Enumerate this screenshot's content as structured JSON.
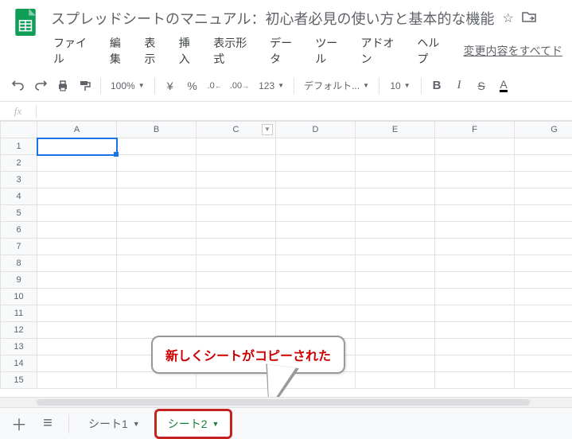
{
  "doc": {
    "title": "スプレッドシートのマニュアル：初心者必見の使い方と基本的な機能"
  },
  "menu": {
    "file": "ファイル",
    "edit": "編集",
    "view": "表示",
    "insert": "挿入",
    "format": "表示形式",
    "data": "データ",
    "tools": "ツール",
    "addons": "アドオン",
    "help": "ヘルプ",
    "save_status": "変更内容をすべてド"
  },
  "toolbar": {
    "zoom": "100%",
    "currency": "¥",
    "percent": "%",
    "dec_dec": ".0",
    "dec_inc": ".00",
    "more_formats": "123",
    "font": "デフォルト...",
    "font_size": "10",
    "bold": "B",
    "italic": "I",
    "strike": "S",
    "color": "A"
  },
  "fx": {
    "label": "fx"
  },
  "grid": {
    "cols": [
      "A",
      "B",
      "C",
      "D",
      "E",
      "F",
      "G"
    ],
    "rows": [
      "1",
      "2",
      "3",
      "4",
      "5",
      "6",
      "7",
      "8",
      "9",
      "10",
      "11",
      "12",
      "13",
      "14",
      "15"
    ]
  },
  "callout": {
    "text": "新しくシートがコピーされた"
  },
  "sheets": {
    "tab1": "シート1",
    "tab2": "シート2"
  }
}
